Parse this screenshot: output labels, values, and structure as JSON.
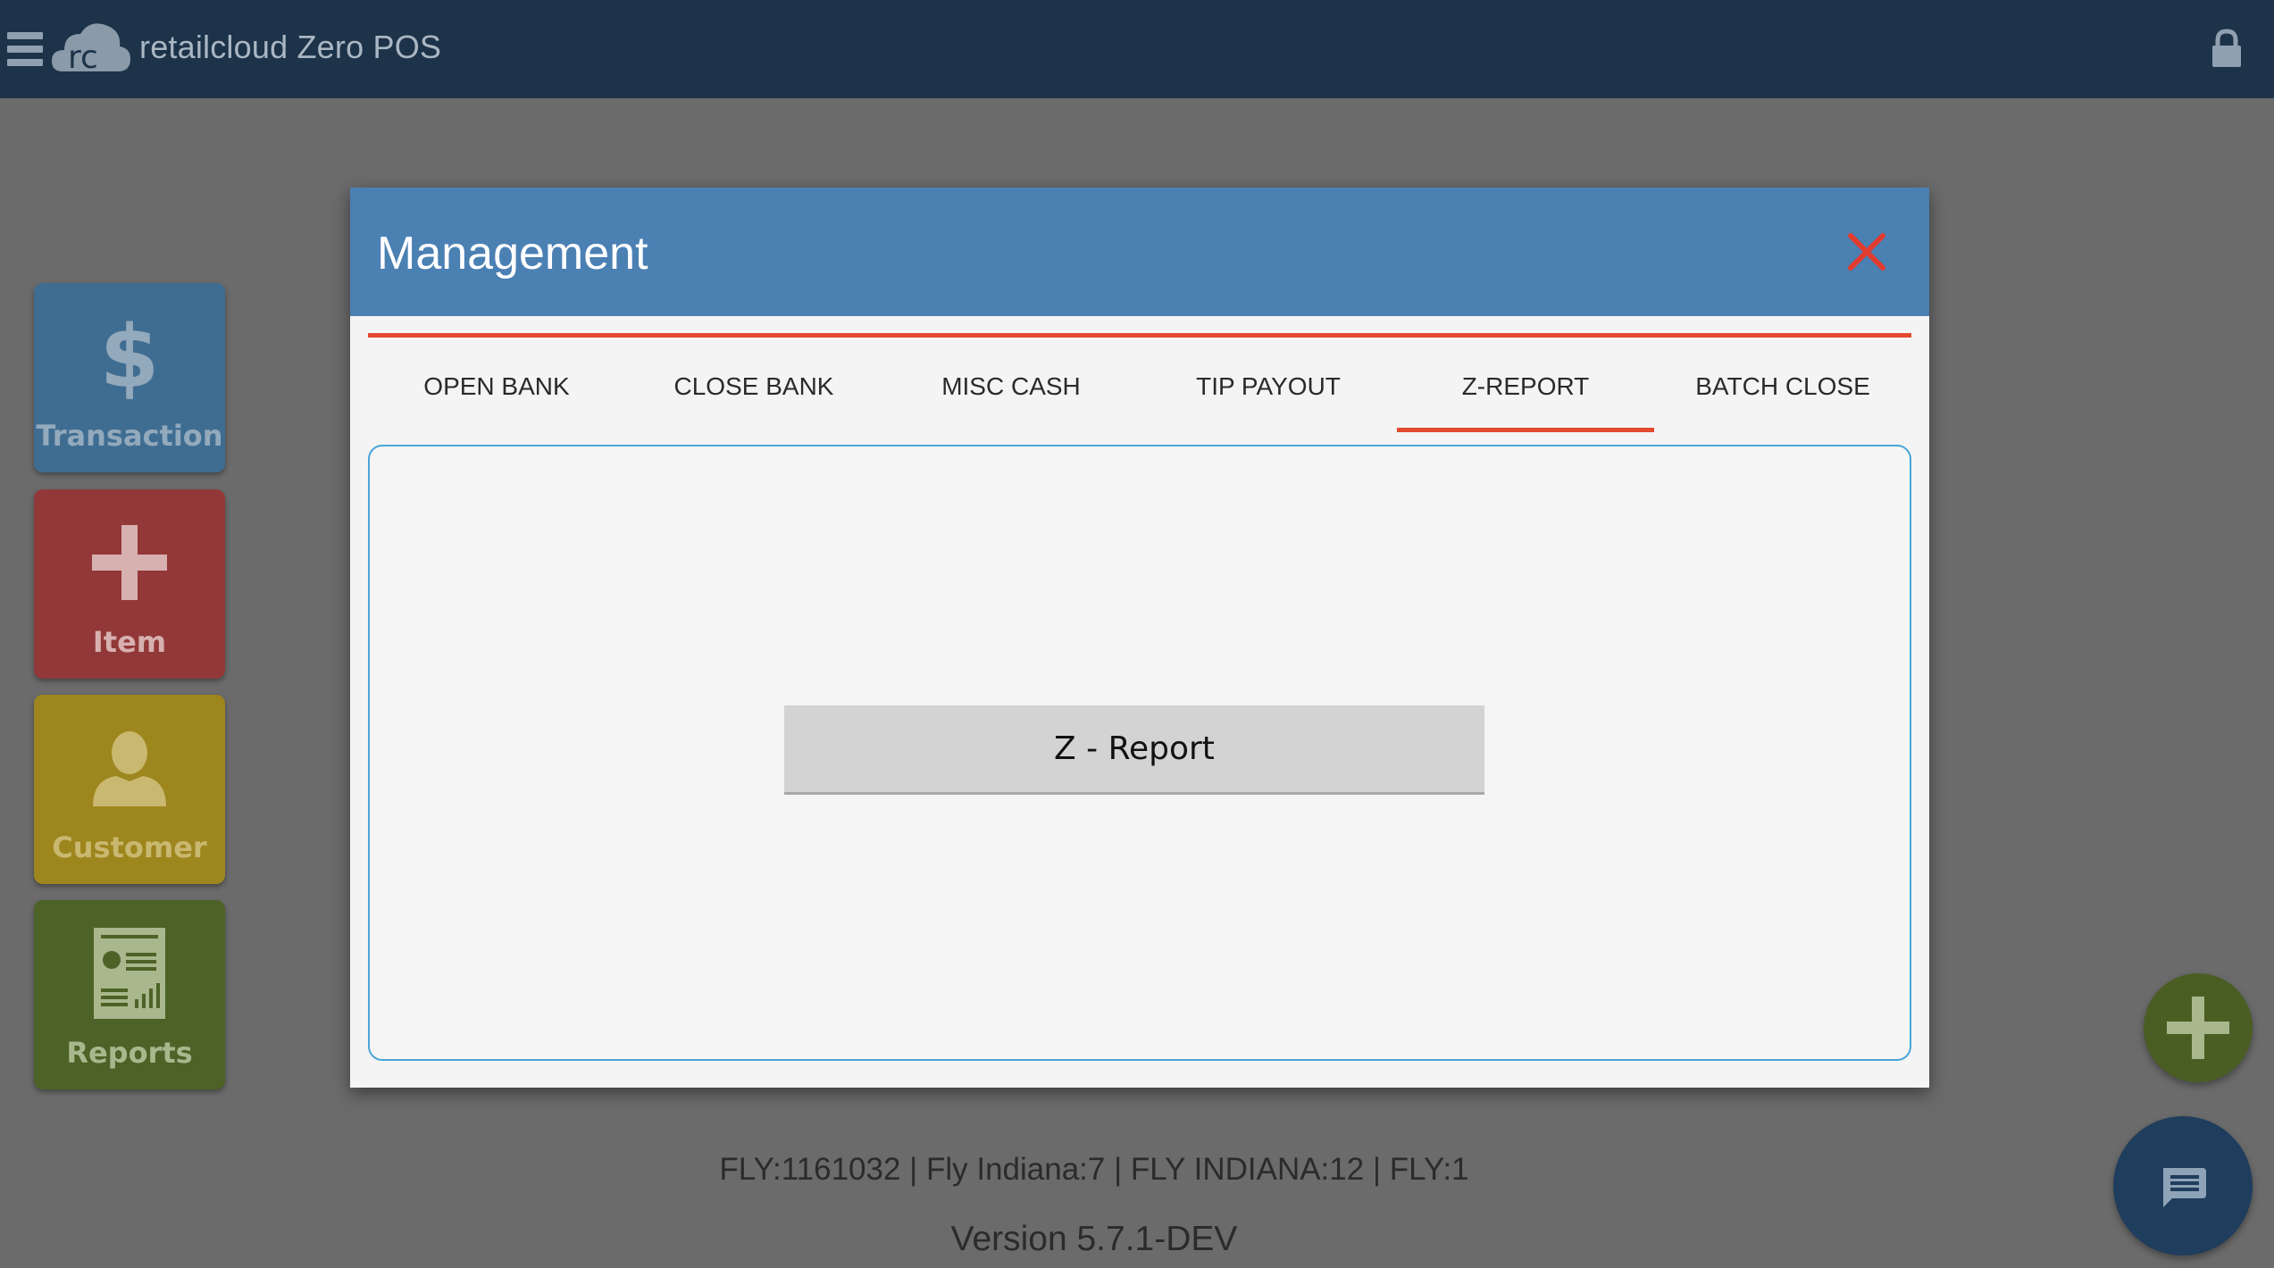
{
  "app": {
    "title": "retailcloud Zero POS",
    "logo_text": "rc"
  },
  "sidebar": {
    "tiles": [
      {
        "label": "Transaction",
        "icon": "dollar-icon"
      },
      {
        "label": "Item",
        "icon": "plus-icon"
      },
      {
        "label": "Customer",
        "icon": "person-icon"
      },
      {
        "label": "Reports",
        "icon": "report-icon"
      }
    ]
  },
  "modal": {
    "title": "Management",
    "tabs": [
      {
        "label": "OPEN BANK",
        "active": false
      },
      {
        "label": "CLOSE BANK",
        "active": false
      },
      {
        "label": "MISC CASH",
        "active": false
      },
      {
        "label": "TIP PAYOUT",
        "active": false
      },
      {
        "label": "Z-REPORT",
        "active": true
      },
      {
        "label": "BATCH CLOSE",
        "active": false
      }
    ],
    "z_report_button": "Z - Report"
  },
  "footer": {
    "store_info": "FLY:1161032 | Fly Indiana:7 | FLY INDIANA:12 | FLY:1",
    "version": "Version 5.7.1-DEV"
  },
  "colors": {
    "topbar": "#1d3349",
    "modal_header": "#4b80b3",
    "accent_red": "#e34a2f",
    "panel_border": "#4aa6d8"
  }
}
